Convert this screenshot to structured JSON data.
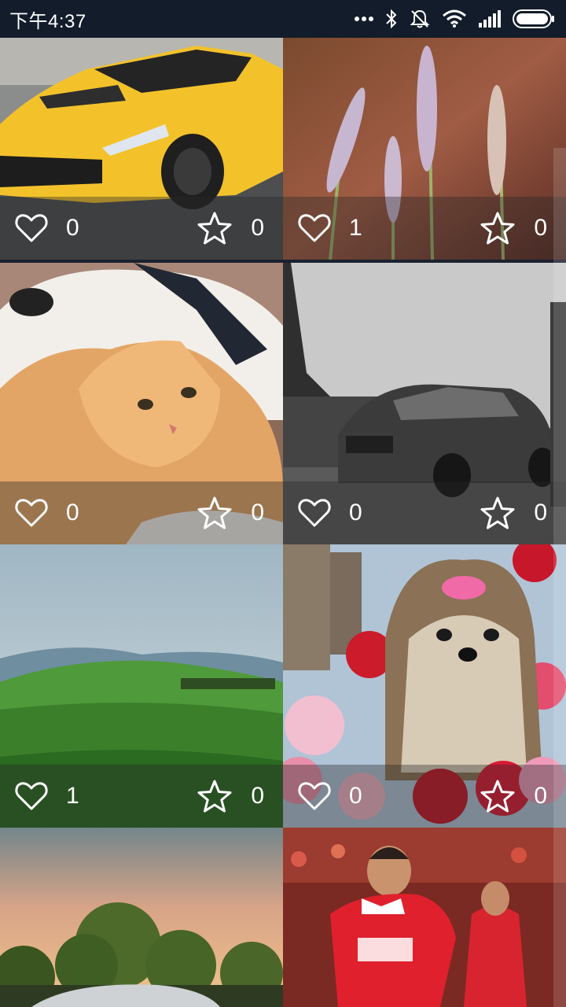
{
  "status_bar": {
    "time": "下午4:37",
    "icons": [
      "more-dots-icon",
      "bluetooth-icon",
      "silent-icon",
      "wifi-icon",
      "signal-icon",
      "battery-icon"
    ]
  },
  "colors": {
    "status_bar_bg": "#121c2a",
    "text": "#ffffff",
    "overlay": "rgba(40,40,40,0.38)"
  },
  "tiles": [
    {
      "subject": "yellow-sports-car",
      "likes": "0",
      "favorites": "0"
    },
    {
      "subject": "lavender-flowers",
      "likes": "1",
      "favorites": "0"
    },
    {
      "subject": "dog-and-cat",
      "likes": "0",
      "favorites": "0"
    },
    {
      "subject": "car-eiffel-tower",
      "likes": "0",
      "favorites": "0"
    },
    {
      "subject": "green-hills",
      "likes": "1",
      "favorites": "0"
    },
    {
      "subject": "yorkshire-terrier-roses",
      "likes": "0",
      "favorites": "0"
    },
    {
      "subject": "sunset-trees-car"
    },
    {
      "subject": "football-player"
    }
  ]
}
